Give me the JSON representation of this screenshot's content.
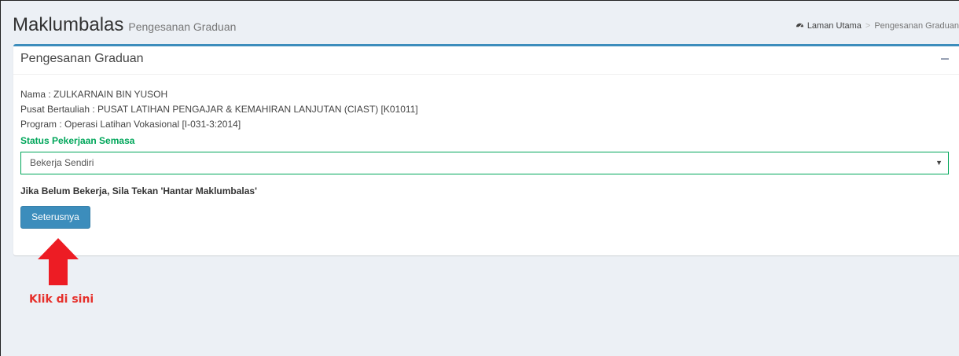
{
  "header": {
    "title": "Maklumbalas",
    "subtitle": "Pengesanan Graduan",
    "breadcrumb": {
      "home_icon": "dashboard-icon",
      "home": "Laman Utama",
      "separator": ">",
      "current": "Pengesanan Graduan"
    }
  },
  "box": {
    "title": "Pengesanan Graduan",
    "collapse_icon": "minus-icon",
    "info": {
      "nama": "Nama : ZULKARNAIN BIN YUSOH",
      "pusat": "Pusat Bertauliah : PUSAT LATIHAN PENGAJAR & KEMAHIRAN LANJUTAN (CIAST) [K01011]",
      "program": "Program : Operasi Latihan Vokasional [I-031-3:2014]"
    },
    "status_label": "Status Pekerjaan Semasa",
    "status_select": {
      "selected": "Bekerja Sendiri",
      "caret": "▼"
    },
    "hint": "Jika Belum Bekerja, Sila Tekan 'Hantar Maklumbalas'",
    "next_button": "Seterusnya"
  },
  "annotation": {
    "text": "Klik di sini",
    "color": "#e6302b"
  },
  "colors": {
    "accent": "#3c8dbc",
    "success": "#00a65a",
    "background": "#ecf0f5"
  }
}
